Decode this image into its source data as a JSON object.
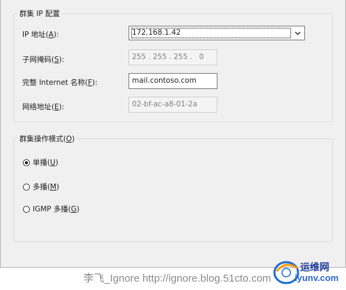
{
  "cluster_ip_group": {
    "legend": "群集 IP 配置",
    "ip_label": "IP 地址(",
    "ip_key": "A",
    "ip_value": "172.168.1.42",
    "mask_label": "子网掩码(",
    "mask_key": "S",
    "mask_segments": [
      "255",
      "255",
      "255",
      "0"
    ],
    "fqdn_label": "完整 Internet 名称(",
    "fqdn_key": "F",
    "fqdn_value": "mail.contoso.com",
    "net_label": "网络地址(",
    "net_key": "E",
    "net_value": "02-bf-ac-a8-01-2a"
  },
  "op_mode_group": {
    "legend_prefix": "群集操作模式(",
    "legend_key": "O",
    "options": [
      {
        "label": "单播(",
        "key": "U",
        "selected": true
      },
      {
        "label": "多播(",
        "key": "M",
        "selected": false
      },
      {
        "label": "IGMP 多播(",
        "key": "G",
        "selected": false
      }
    ]
  },
  "watermark": {
    "text": "李飞_Ignore    http://ignore.blog.51cto.com"
  },
  "site_logo": {
    "line1": "运维网",
    "line2": "iyunv.com"
  },
  "icons": [
    "chevron-down-icon",
    "radio-icon",
    "globe-logo-icon"
  ],
  "colors": {
    "dialog_bg": "#f0f0f0",
    "border": "#7a7a7a",
    "disabled_text": "#808080"
  }
}
